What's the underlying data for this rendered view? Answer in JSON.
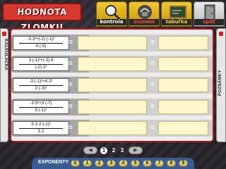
{
  "app": {
    "title": "Hodnota zlomku"
  },
  "tabs": [
    {
      "label": "kontrola",
      "icon": "magnifier-icon"
    },
    {
      "label": "zoznam",
      "icon": "list-icon"
    },
    {
      "label": "tabuľka",
      "icon": "board-icon"
    },
    {
      "label": "späť",
      "icon": "door-exit-icon"
    }
  ],
  "side": {
    "left_label": "KALKULAČKA",
    "right_label": "POZNÁMKY"
  },
  "equals": "=",
  "rows": [
    {
      "num": "-3·3²+(-2)·(-1)²",
      "den": "4·(-5)"
    },
    {
      "num": "3·(-1)³+(-3)·8",
      "den": "(-2)·2²"
    },
    {
      "num": "-3·(-1)³+4·2²",
      "den": "2·(-3)³"
    },
    {
      "num": "-3·5²+3·(-7)",
      "den": "5·(-1)²"
    },
    {
      "num": "5·3·2·(-1)²",
      "den": "3·2"
    }
  ],
  "pager": {
    "prev": "◀",
    "next": "▶",
    "pages": [
      "1",
      "2",
      "3"
    ],
    "current": "1"
  },
  "exponents": {
    "label": "EXPONENTY",
    "keys": [
      "0",
      "1",
      "2",
      "3",
      "4",
      "5",
      "6",
      "7",
      "8",
      "9"
    ]
  },
  "colors": {
    "accent": "#d8382e",
    "panel": "#ececec",
    "answer": "#fff7cc",
    "expbar": "#3a5a90"
  }
}
